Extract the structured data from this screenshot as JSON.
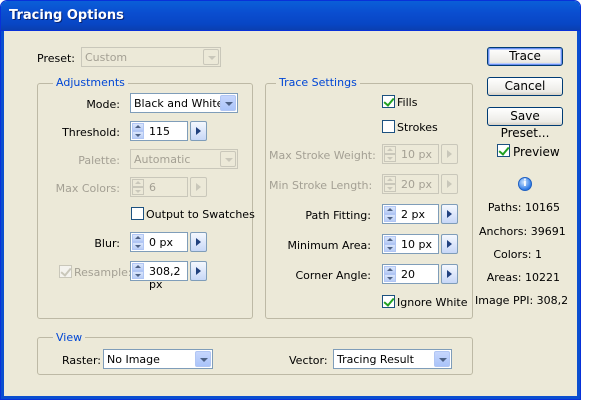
{
  "window": {
    "title": "Tracing Options"
  },
  "preset": {
    "label": "Preset:",
    "value": "Custom"
  },
  "adjustments": {
    "title": "Adjustments",
    "mode": {
      "label": "Mode:",
      "value": "Black and White"
    },
    "threshold": {
      "label": "Threshold:",
      "value": "115"
    },
    "palette": {
      "label": "Palette:",
      "value": "Automatic"
    },
    "max_colors": {
      "label": "Max Colors:",
      "value": "6"
    },
    "output_to_swatches": {
      "label": "Output to Swatches",
      "checked": false
    },
    "blur": {
      "label": "Blur:",
      "value": "0 px"
    },
    "resample": {
      "label": "Resample:",
      "value": "308,2 px",
      "checked": true
    }
  },
  "trace_settings": {
    "title": "Trace Settings",
    "fills": {
      "label": "Fills",
      "checked": true
    },
    "strokes": {
      "label": "Strokes",
      "checked": false
    },
    "max_stroke_weight": {
      "label": "Max Stroke Weight:",
      "value": "10 px"
    },
    "min_stroke_length": {
      "label": "Min Stroke Length:",
      "value": "20 px"
    },
    "path_fitting": {
      "label": "Path Fitting:",
      "value": "2 px"
    },
    "minimum_area": {
      "label": "Minimum Area:",
      "value": "10 px"
    },
    "corner_angle": {
      "label": "Corner Angle:",
      "value": "20"
    },
    "ignore_white": {
      "label": "Ignore White",
      "checked": true
    }
  },
  "view": {
    "title": "View",
    "raster": {
      "label": "Raster:",
      "value": "No Image"
    },
    "vector": {
      "label": "Vector:",
      "value": "Tracing Result"
    }
  },
  "buttons": {
    "trace": "Trace",
    "cancel": "Cancel",
    "save_preset": "Save Preset..."
  },
  "preview": {
    "label": "Preview",
    "checked": true
  },
  "info_icon": "i",
  "stats": {
    "paths": "Paths: 10165",
    "anchors": "Anchors: 39691",
    "colors": "Colors: 1",
    "areas": "Areas: 10221",
    "image_ppi": "Image PPI: 308,2"
  },
  "colors": {
    "title_bar": "#0a4ed0",
    "dialog_bg": "#ece9d8",
    "group_title": "#0046d5",
    "check": "#21a121"
  }
}
